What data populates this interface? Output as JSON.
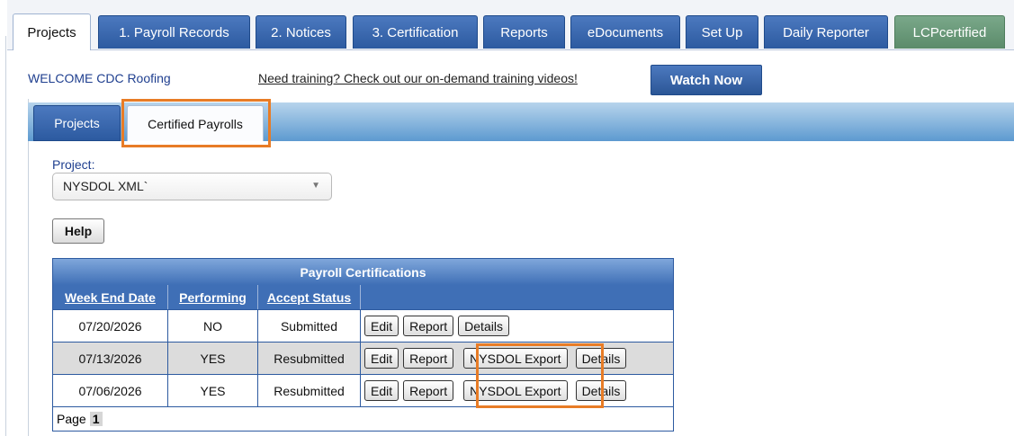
{
  "top_tabs": [
    {
      "label": "Projects"
    },
    {
      "label": "1. Payroll Records"
    },
    {
      "label": "2. Notices"
    },
    {
      "label": "3. Certification"
    },
    {
      "label": "Reports"
    },
    {
      "label": "eDocuments"
    },
    {
      "label": "Set Up"
    },
    {
      "label": "Daily Reporter"
    },
    {
      "label": "LCPcertified"
    }
  ],
  "welcome": "WELCOME CDC Roofing",
  "training_link": "Need training? Check out our on-demand training videos!",
  "watch_now": "Watch Now",
  "sub_tabs": {
    "projects": "Projects",
    "certified": "Certified Payrolls"
  },
  "project": {
    "label": "Project:",
    "selected": "NYSDOL XML`"
  },
  "help": "Help",
  "grid": {
    "caption": "Payroll Certifications",
    "headers": [
      "Week End Date",
      "Performing",
      "Accept Status"
    ],
    "rows": [
      {
        "date": "07/20/2026",
        "performing": "NO",
        "status": "Submitted",
        "buttons": [
          "Edit",
          "Report",
          "Details"
        ]
      },
      {
        "date": "07/13/2026",
        "performing": "YES",
        "status": "Resubmitted",
        "buttons": [
          "Edit",
          "Report",
          "NYSDOL Export",
          "Details"
        ]
      },
      {
        "date": "07/06/2026",
        "performing": "YES",
        "status": "Resubmitted",
        "buttons": [
          "Edit",
          "Report",
          "NYSDOL Export",
          "Details"
        ]
      }
    ],
    "pager_label": "Page",
    "page": "1"
  },
  "colors": {
    "accent_blue": "#2c5aa0",
    "highlight_orange": "#e87c26",
    "lcp_green": "#5b8b6a"
  }
}
